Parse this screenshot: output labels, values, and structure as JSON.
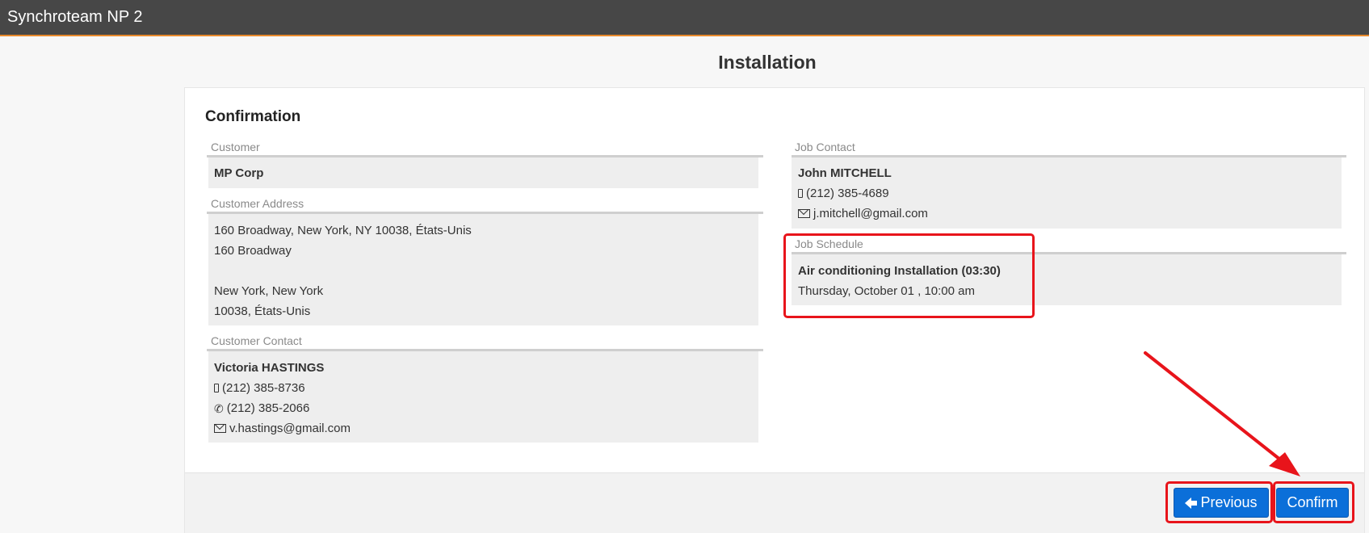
{
  "app": {
    "title": "Synchroteam NP 2"
  },
  "page": {
    "title": "Installation"
  },
  "panel": {
    "heading": "Confirmation"
  },
  "customer": {
    "label": "Customer",
    "name": "MP Corp"
  },
  "customer_address": {
    "label": "Customer Address",
    "lines": [
      "160 Broadway, New York, NY 10038, États-Unis",
      "160 Broadway",
      "",
      "New York, New York",
      "10038, États-Unis"
    ]
  },
  "customer_contact": {
    "label": "Customer Contact",
    "name": "Victoria HASTINGS",
    "mobile": "(212) 385-8736",
    "phone": "(212) 385-2066",
    "email": "v.hastings@gmail.com"
  },
  "job_contact": {
    "label": "Job Contact",
    "name": "John MITCHELL",
    "mobile": "(212) 385-4689",
    "email": "j.mitchell@gmail.com"
  },
  "job_schedule": {
    "label": "Job Schedule",
    "title": "Air conditioning Installation (03:30)",
    "datetime": "Thursday, October 01 , 10:00 am"
  },
  "buttons": {
    "previous_label": "Previous",
    "confirm_label": "Confirm"
  },
  "colors": {
    "topbar": "#474747",
    "accent_line": "#e8892b",
    "button": "#0b6fd9",
    "annotation": "#e8141b"
  }
}
